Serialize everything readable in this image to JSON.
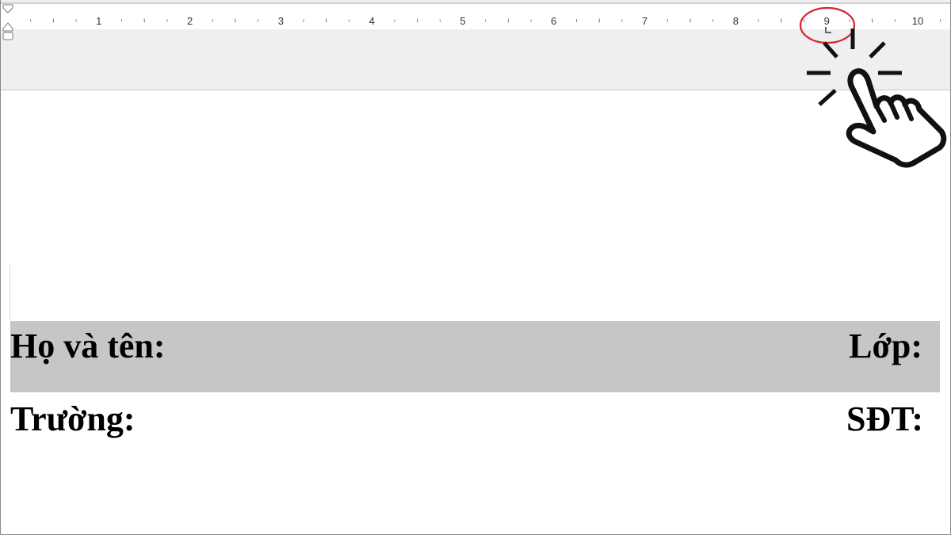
{
  "ruler": {
    "numbers": [
      "1",
      "2",
      "3",
      "4",
      "5",
      "6",
      "7",
      "8",
      "9",
      "10"
    ],
    "tab_stop_symbol": "L"
  },
  "document": {
    "row1": {
      "left_label": "Họ và tên:",
      "right_label": "Lớp:",
      "shading": "#c6c6c6"
    },
    "row2": {
      "left_label": "Trường:",
      "right_label": "SĐT:"
    }
  },
  "annotation": {
    "highlight_color": "#d9232d",
    "icon": "pointing-hand-icon"
  }
}
